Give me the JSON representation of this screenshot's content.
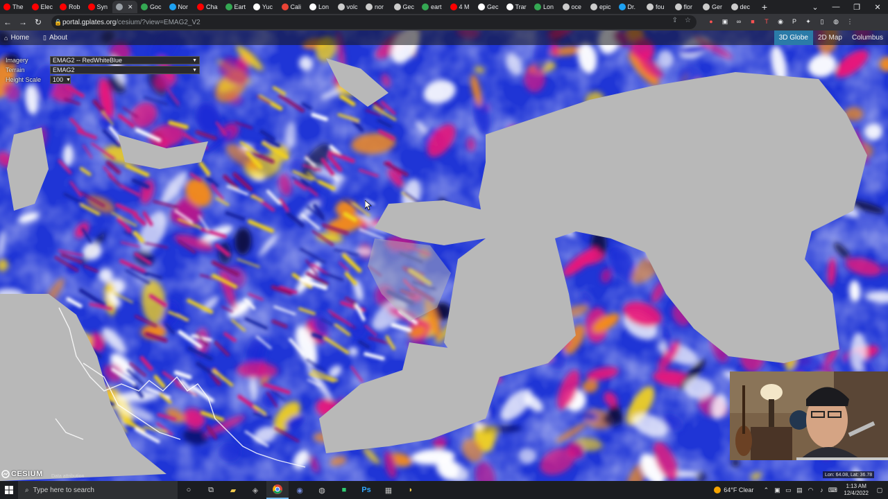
{
  "browser": {
    "tabs": [
      {
        "label": "The",
        "color": "#ff0000"
      },
      {
        "label": "Elec",
        "color": "#ff0000"
      },
      {
        "label": "Rob",
        "color": "#ff0000"
      },
      {
        "label": "Syn",
        "color": "#ff0000"
      },
      {
        "label": "",
        "color": "#9aa0a6",
        "active": true
      },
      {
        "label": "Goc",
        "color": "#34a853"
      },
      {
        "label": "Nor",
        "color": "#1da1f2"
      },
      {
        "label": "Cha",
        "color": "#ff0000"
      },
      {
        "label": "Eart",
        "color": "#34a853"
      },
      {
        "label": "Yuc",
        "color": "#ffffff"
      },
      {
        "label": "Cali",
        "color": "#ea4335"
      },
      {
        "label": "Lon",
        "color": "#ffffff"
      },
      {
        "label": "volc",
        "color": "#cccccc"
      },
      {
        "label": "nor",
        "color": "#cccccc"
      },
      {
        "label": "Gec",
        "color": "#cccccc"
      },
      {
        "label": "eart",
        "color": "#34a853"
      },
      {
        "label": "4 M",
        "color": "#ff0000"
      },
      {
        "label": "Gec",
        "color": "#ffffff"
      },
      {
        "label": "Trar",
        "color": "#ffffff"
      },
      {
        "label": "Lon",
        "color": "#34a853"
      },
      {
        "label": "oce",
        "color": "#cccccc"
      },
      {
        "label": "epic",
        "color": "#cccccc"
      },
      {
        "label": "Dr.",
        "color": "#1da1f2"
      },
      {
        "label": "fou",
        "color": "#cccccc"
      },
      {
        "label": "flor",
        "color": "#cccccc"
      },
      {
        "label": "Ger",
        "color": "#cccccc"
      },
      {
        "label": "dec",
        "color": "#cccccc"
      }
    ],
    "url_host": "portal.gplates.org",
    "url_path": "/cesium/?view=EMAG2_V2"
  },
  "app": {
    "nav": {
      "home": "Home",
      "about": "About"
    },
    "modes": [
      "3D Globe",
      "2D Map",
      "Columbus"
    ],
    "active_mode": "3D Globe",
    "controls": {
      "imagery_label": "Imagery",
      "imagery_value": "EMAG2 -- RedWhiteBlue",
      "terrain_label": "Terrain",
      "terrain_value": "EMAG2",
      "height_label": "Height Scale",
      "height_value": "100"
    },
    "logo": "CESIUM",
    "credits": "Data attribution",
    "coordinates": "Lon: 64.08, Lat: 36.78"
  },
  "taskbar": {
    "search_placeholder": "Type here to search",
    "weather": "64°F  Clear",
    "time": "1:13 AM",
    "date": "12/4/2022"
  },
  "icons": {
    "windows": "windows-icon",
    "search": "search-icon",
    "chrome": "chrome-icon"
  }
}
